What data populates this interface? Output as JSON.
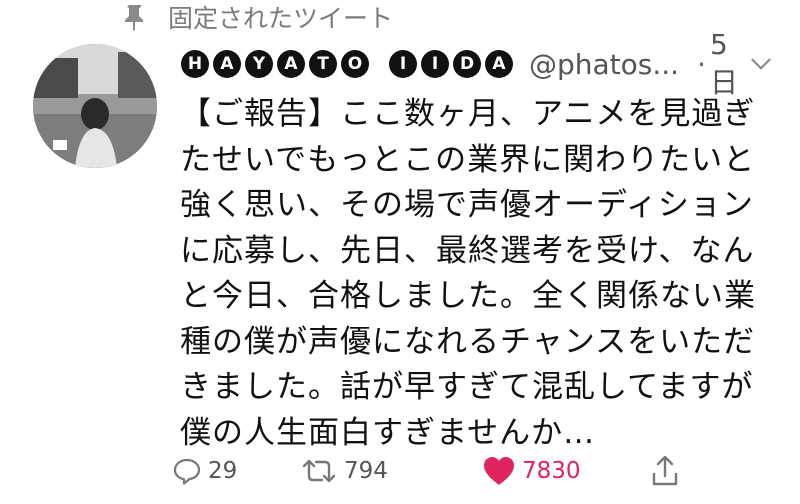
{
  "pinned": {
    "label": "固定されたツイート",
    "icon": "pin-icon"
  },
  "author": {
    "name_letters_first": [
      "H",
      "A",
      "Y",
      "A",
      "T",
      "O"
    ],
    "name_letters_last": [
      "I",
      "I",
      "D",
      "A"
    ],
    "handle": "@phatos...",
    "separator": "·",
    "time": "5日"
  },
  "tweet": {
    "text": "【ご報告】ここ数ヶ月、アニメを見過ぎたせいでもっとこの業界に関わりたいと強く思い、その場で声優オーディションに応募し、先日、最終選考を受け、なんと今日、合格しました。全く関係ない業種の僕が声優になれるチャンスをいただきました。話が早すぎて混乱してますが僕の人生面白すぎませんか…"
  },
  "actions": {
    "reply_count": "29",
    "retweet_count": "794",
    "like_count": "7830",
    "like_color": "#e0245e"
  }
}
